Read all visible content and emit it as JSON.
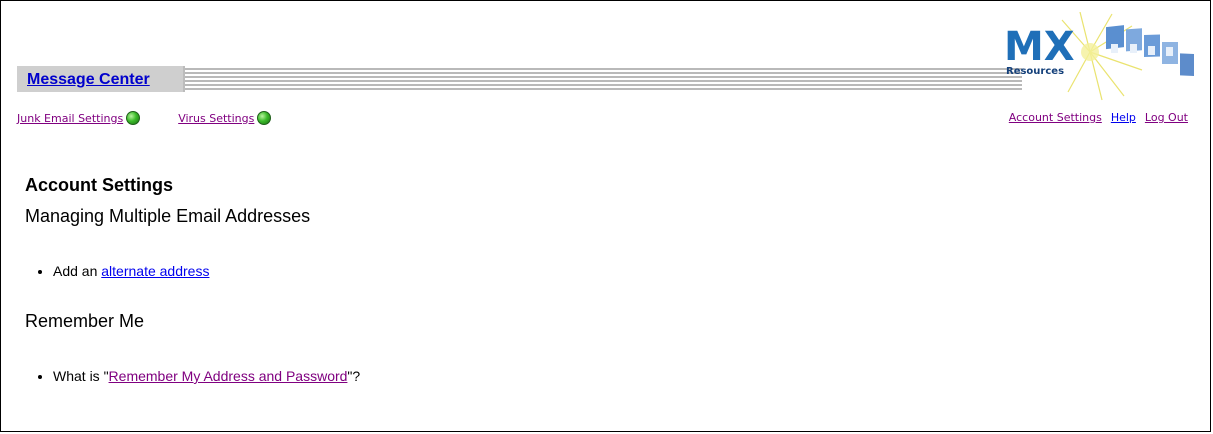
{
  "header": {
    "message_center": "Message Center"
  },
  "logo": {
    "mark": "MX",
    "subtitle": "Resources",
    "accent": "#1f6fb8"
  },
  "nav": {
    "junk_email_settings": "Junk Email Settings",
    "virus_settings": "Virus Settings",
    "account_settings": "Account Settings",
    "help": "Help",
    "log_out": "Log Out",
    "status_color": "#3bbb2a"
  },
  "page": {
    "title": "Account Settings",
    "section1_title": "Managing Multiple Email Addresses",
    "item1_prefix": "Add an ",
    "item1_link": "alternate address",
    "section2_title": "Remember Me",
    "item2_prefix": "What is \"",
    "item2_link": "Remember My Address and Password",
    "item2_suffix": "\"?"
  }
}
